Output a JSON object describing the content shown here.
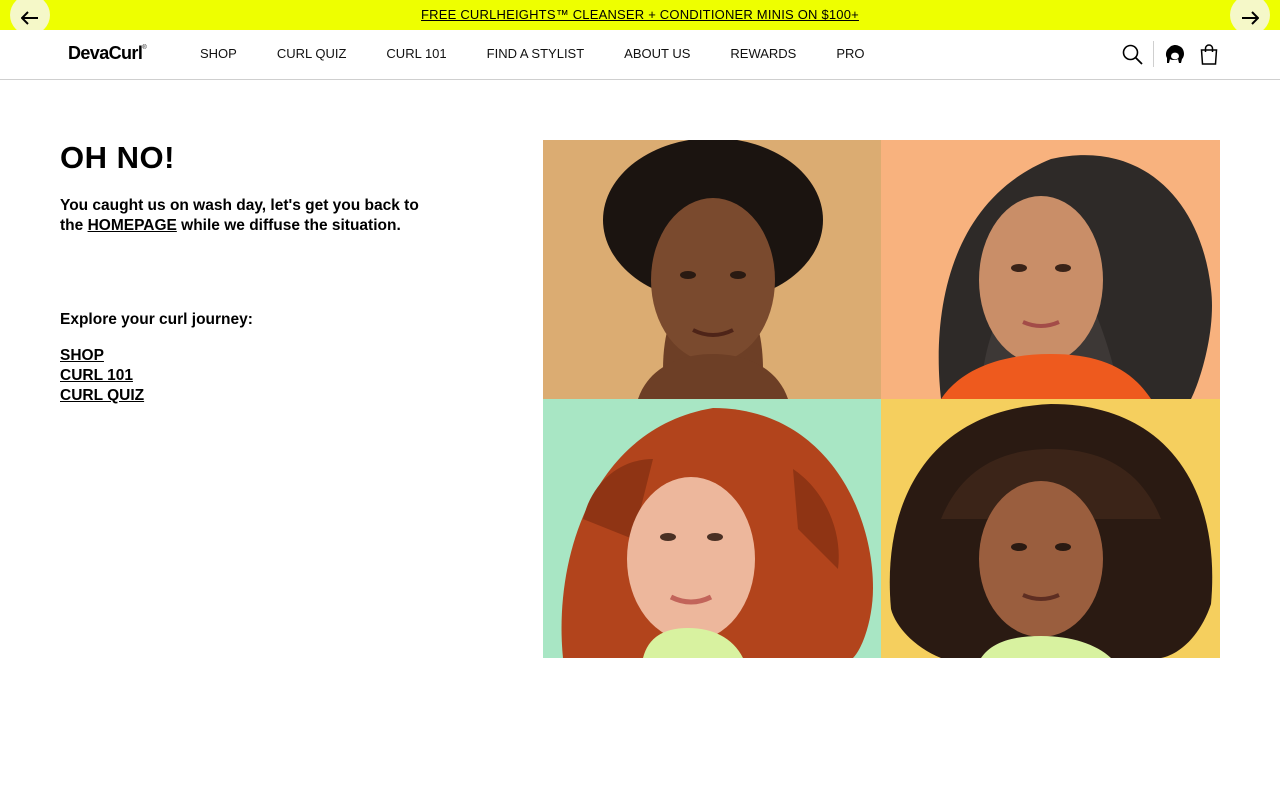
{
  "promo": {
    "text": "FREE CURLHEIGHTS™ CLEANSER + CONDITIONER MINIS ON $100+",
    "prev_icon": "arrow-left-icon",
    "next_icon": "arrow-right-icon",
    "background": "#eeff00"
  },
  "header": {
    "logo": "DevaCurl",
    "logo_mark": "®",
    "nav": [
      "SHOP",
      "CURL QUIZ",
      "CURL 101",
      "FIND A STYLIST",
      "ABOUT US",
      "REWARDS",
      "PRO"
    ],
    "icons": [
      "search-icon",
      "curl-profile-icon",
      "shopping-bag-icon"
    ]
  },
  "main": {
    "heading": "OH NO!",
    "intro_before": "You caught us on wash day, let's get you back to the ",
    "intro_link": "HOMEPAGE",
    "intro_after": " while we diffuse the situation.",
    "explore": "Explore your curl journey:",
    "links": [
      "SHOP",
      "CURL 101",
      "CURL QUIZ"
    ]
  },
  "grid": {
    "tiles": [
      {
        "subject": "woman with short black coily hair",
        "background": "#e2b47a",
        "hair": "#1b1410",
        "skin": "#7a4a2e"
      },
      {
        "subject": "woman with long gray curly hair",
        "background": "#f8b27e",
        "hair": "#2e2a28",
        "skin": "#c98e68"
      },
      {
        "subject": "woman with red curly hair",
        "background": "#a8e6c4",
        "hair": "#b2441c",
        "skin": "#edb79c"
      },
      {
        "subject": "woman with dark brown curly hair",
        "background": "#f5cf5e",
        "hair": "#2a1a12",
        "skin": "#9a5e3e"
      }
    ]
  }
}
